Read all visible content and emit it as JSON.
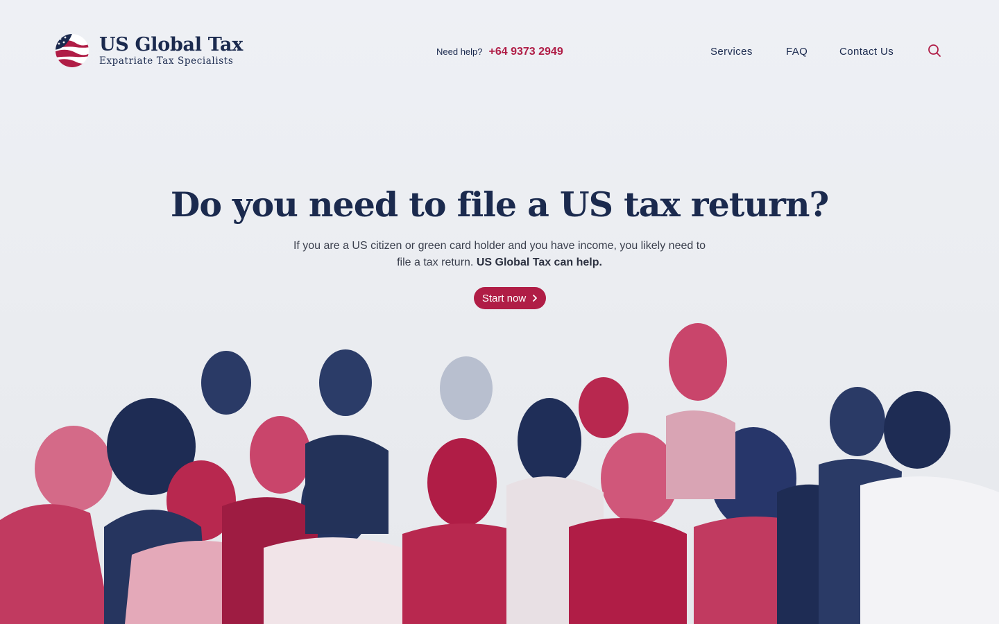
{
  "brand": {
    "title": "US Global Tax",
    "subtitle": "Expatriate Tax Specialists",
    "logo_icon": "us-flag-globe-icon"
  },
  "help": {
    "label": "Need help?",
    "phone": "+64 9373 2949"
  },
  "nav": {
    "items": [
      {
        "label": "Services"
      },
      {
        "label": "FAQ"
      },
      {
        "label": "Contact Us"
      }
    ],
    "search_icon": "search-icon"
  },
  "hero": {
    "title": "Do you need to file a US tax return?",
    "text_plain": "If you are a US citizen or green card holder and you have income, you likely need to file a tax return.",
    "text_bold": "US Global Tax can help.",
    "cta_label": "Start now",
    "cta_icon": "chevron-right-icon"
  },
  "colors": {
    "navy": "#1b2a4e",
    "crimson": "#b01d46",
    "background": "#eef0f4"
  }
}
